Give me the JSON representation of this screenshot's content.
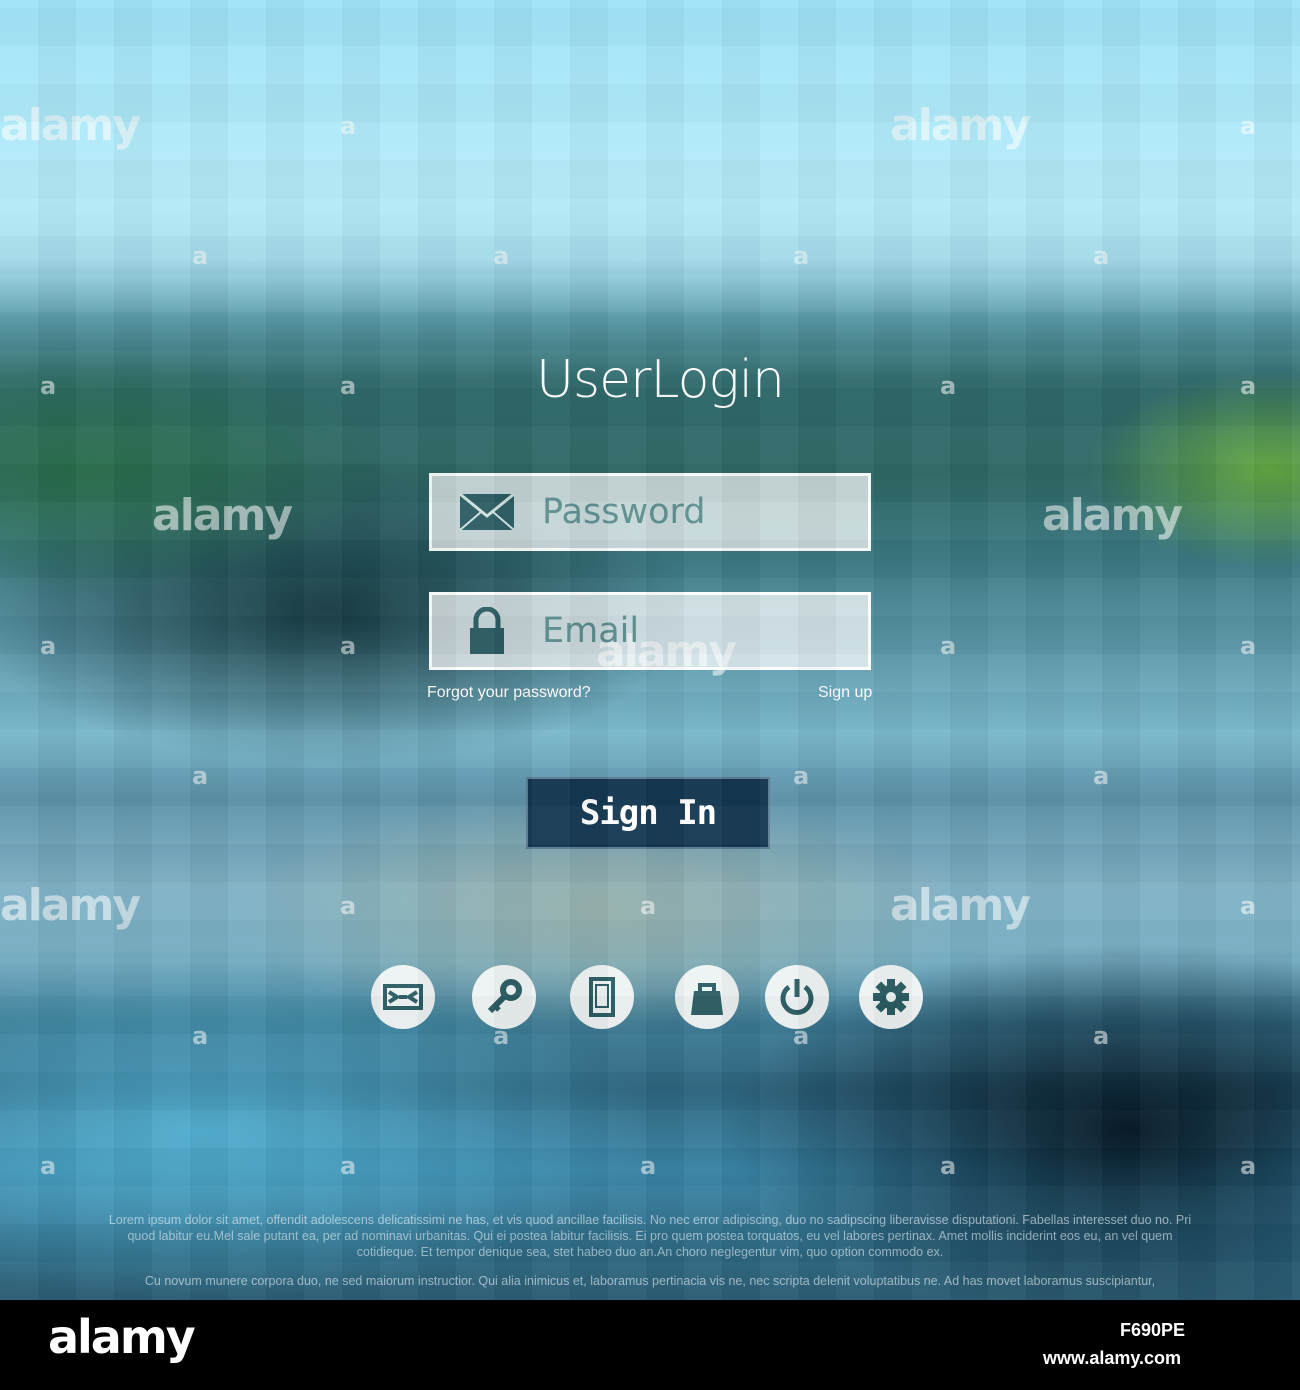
{
  "login": {
    "title": "UserLogin",
    "field_1": {
      "icon": "envelope-icon",
      "value": "Password"
    },
    "field_2": {
      "icon": "lock-icon",
      "value": "Email"
    },
    "forgot_link": "Forgot your password?",
    "signup_link": "Sign up",
    "signin_button": "Sign In"
  },
  "icon_row": [
    "mail-icon",
    "key-icon",
    "smartphone-icon",
    "shopping-bag-icon",
    "power-icon",
    "gear-icon"
  ],
  "lorem": {
    "paragraph": "Lorem ipsum dolor sit amet, offendit adolescens delicatissimi ne has, et vis quod ancillae facilisis. No nec error adipiscing, duo no sadipscing liberavisse disputationi. Fabellas interesset duo no. Pri quod labitur eu.Mel sale putant ea, per ad nominavi urbanitas. Qui ei postea labitur facilisis. Ei pro quem postea torquatos, eu vel labores pertinax. Amet mollis inciderint eos eu, an vel quem cotidieque. Et tempor denique sea, stet habeo duo an.An choro neglegentur vim, quo option commodo ex.",
    "line": "Cu novum munere corpora duo, ne sed maiorum instructior. Qui alia inimicus et, laboramus pertinacia vis ne, nec scripta delenit voluptatibus ne. Ad has movet laboramus suscipiantur,"
  },
  "watermark": {
    "word": "alamy",
    "letter": "a"
  },
  "footer": {
    "logo": "alamy",
    "image_id": "F690PE",
    "url": "www.alamy.com"
  },
  "colors": {
    "button_bg": "#153852",
    "field_text": "#5c8f8e",
    "icon_fill": "#2b5d63"
  }
}
